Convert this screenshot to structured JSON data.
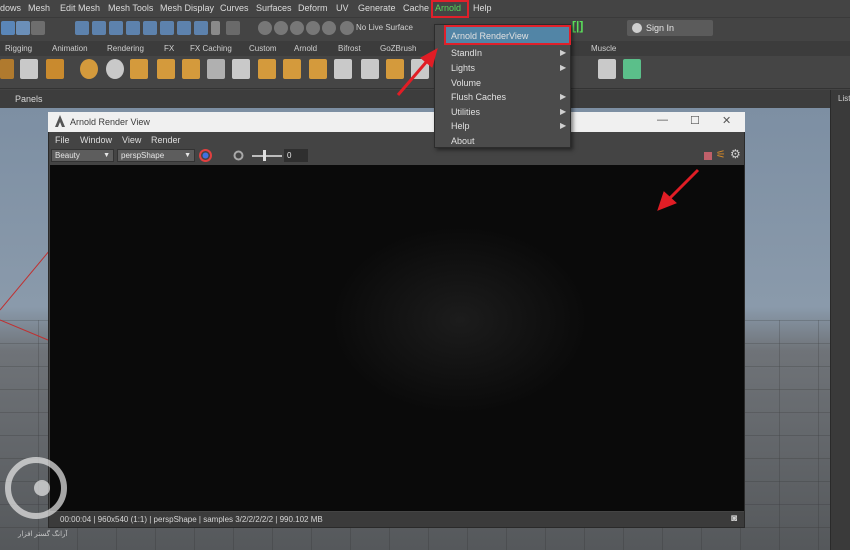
{
  "menubar": {
    "items": [
      "dows",
      "Mesh",
      "Edit Mesh",
      "Mesh Tools",
      "Mesh Display",
      "Curves",
      "Surfaces",
      "Deform",
      "UV",
      "Generate",
      "Cache",
      "Arnold",
      "Help"
    ]
  },
  "statusline": {
    "live_surface": "No Live Surface",
    "signin": "Sign In"
  },
  "shelf_tabs": [
    "Rigging",
    "Animation",
    "Rendering",
    "FX",
    "FX Caching",
    "Custom",
    "Arnold",
    "Bifrost",
    "GoZBrush",
    "Muscle"
  ],
  "panels": {
    "label": "Panels",
    "right_list_label": "List"
  },
  "arnold_menu": {
    "items": [
      {
        "label": "Arnold RenderView",
        "submenu": false
      },
      {
        "label": "StandIn",
        "submenu": true
      },
      {
        "label": "Lights",
        "submenu": true
      },
      {
        "label": "Volume",
        "submenu": false
      },
      {
        "label": "Flush Caches",
        "submenu": true
      },
      {
        "label": "Utilities",
        "submenu": true
      },
      {
        "label": "Help",
        "submenu": true
      },
      {
        "label": "About",
        "submenu": false
      }
    ]
  },
  "render_view": {
    "title": "Arnold Render View",
    "menu": [
      "File",
      "Window",
      "View",
      "Render"
    ],
    "aov": "Beauty",
    "camera": "perspShape",
    "exposure": "0",
    "status": "00:00:04 | 960x540 (1:1) | perspShape  | samples 3/2/2/2/2/2 | 990.102 MB"
  },
  "watermark": {
    "text": "آرانگ گستر افزار"
  },
  "colors": {
    "annotation_red": "#e11d25",
    "menu_highlight": "#5285a6",
    "arnold_green": "#58d858"
  },
  "icons": [
    "select-icon",
    "lasso-icon",
    "paint-icon",
    "snap-grid-icon",
    "snap-curve-icon",
    "snap-point-icon",
    "lock-icon",
    "bracket-icon",
    "signin-user-icon",
    "arnold-logo-icon",
    "rss-icon",
    "gear-icon",
    "stop-icon",
    "camera-icon",
    "color-wheel-icon"
  ]
}
